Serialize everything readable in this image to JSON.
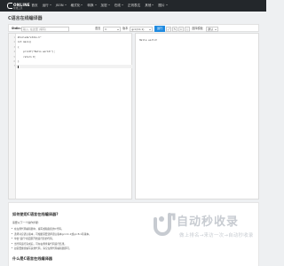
{
  "nav": {
    "logo_title": "ONLINE",
    "logo_subtitle": "在线工具",
    "items": [
      {
        "label": "首页",
        "caret": false
      },
      {
        "label": "运行",
        "caret": true
      },
      {
        "label": "JSON",
        "caret": true
      },
      {
        "label": "格式化",
        "caret": true
      },
      {
        "label": "转换",
        "caret": true
      },
      {
        "label": "加密",
        "caret": true
      },
      {
        "label": "在线",
        "caret": true
      },
      {
        "label": "正则表达",
        "caret": false
      },
      {
        "label": "其他",
        "caret": true
      },
      {
        "label": "图片",
        "caret": true
      }
    ]
  },
  "page": {
    "title": "C语言在线编译器"
  },
  "toolbar": {
    "stdin_label": "Stdin:",
    "stdin_placeholder": "输入, 在这里 (填写)",
    "lang_label": "语言",
    "lang_value": "C",
    "version_label": "版本",
    "version_value": "gcc(11.1)",
    "run_label": "运行",
    "btn_a": "⤢",
    "btn_b": "✎",
    "btn_c": "↓",
    "btn_d": "⤓",
    "theme_label": "选择模板",
    "theme_value": "默认"
  },
  "editor": {
    "lines": [
      "#include\"stdio.h\"",
      "int main()",
      "{",
      "    printf(\"Hello world!\");",
      "    return 0;",
      "}",
      ""
    ]
  },
  "output": {
    "text": "Hello world!"
  },
  "article": {
    "heading1": "如何使用C语言在线编译器?",
    "intro": "需要以下一个操作步骤:",
    "steps": [
      "在左侧代码编辑器中，编写或粘贴您的C代码。",
      "选择对应语言版本，可根据需要选择语言版本gcc11.1或gcc8.1等版本。",
      "单击\"运行\"按钮即开始运行您的代码。",
      "当代码运行完成后，可在右侧查看代码运行结果。",
      "如需要继续编写其他代码，清空左侧代码编辑器即可。"
    ],
    "heading2": "什么是C语言在线编译器"
  },
  "watermark": {
    "title": "自动秒收录",
    "subtitle": "做上排名→来访一次→自动秒收录"
  }
}
